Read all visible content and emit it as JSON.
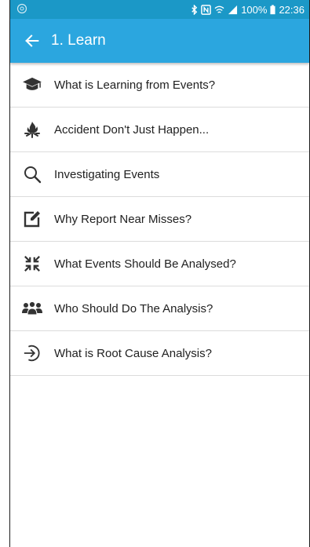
{
  "status_bar": {
    "battery": "100%",
    "time": "22:36",
    "icons": [
      "app-status-icon",
      "bluetooth-icon",
      "nfc-icon",
      "wifi-icon",
      "signal-icon",
      "battery-icon"
    ]
  },
  "app_bar": {
    "title": "1. Learn",
    "back_icon": "arrow-left-icon"
  },
  "colors": {
    "app_bar": "#2ba6df",
    "status_bar": "#1b98c7",
    "icon": "#333333",
    "divider": "#dcdcdc"
  },
  "items": [
    {
      "label": "What is Learning from Events?",
      "icon": "graduation-cap-icon"
    },
    {
      "label": "Accident Don't Just Happen...",
      "icon": "fire-icon"
    },
    {
      "label": "Investigating Events",
      "icon": "search-icon"
    },
    {
      "label": "Why Report Near Misses?",
      "icon": "edit-icon"
    },
    {
      "label": "What Events Should Be Analysed?",
      "icon": "compress-icon"
    },
    {
      "label": "Who Should Do The Analysis?",
      "icon": "group-icon"
    },
    {
      "label": "What is Root Cause Analysis?",
      "icon": "sign-in-icon"
    }
  ]
}
